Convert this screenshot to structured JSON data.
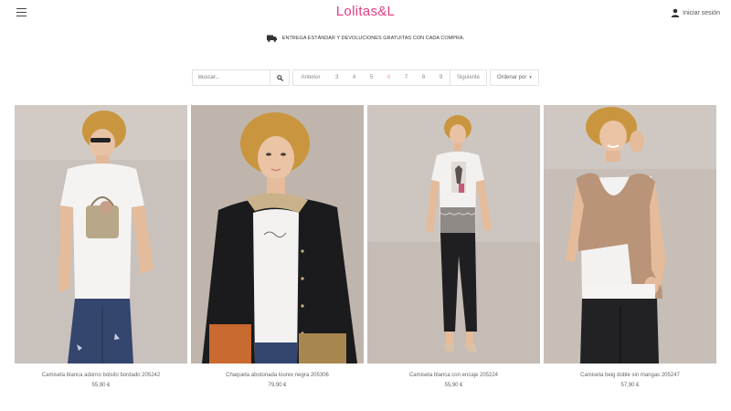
{
  "header": {
    "brand": "Lolitas&L",
    "login_label": "Iniciar sesión",
    "brand_color": "#e63c86"
  },
  "banner": {
    "text": "ENTREGA ESTÁNDAR Y DEVOLUCIONES GRATUITAS CON CADA COMPRA."
  },
  "toolbar": {
    "search_placeholder": "Buscar...",
    "prev_label": "Anterior",
    "pages": [
      "3",
      "4",
      "5",
      "6",
      "7",
      "8",
      "9"
    ],
    "current_page": "6",
    "next_label": "Siguiente",
    "sort_label": "Ordenar por",
    "active_color": "#f29bbb"
  },
  "products": [
    {
      "name": "Camiseta blanca adorno bolsito bordado 205242",
      "price": "55,90 €"
    },
    {
      "name": "Chaqueta abotonada lourex negra 205306",
      "price": "79,90 €"
    },
    {
      "name": "Camiseta blanca con encaje 205224",
      "price": "55,90 €"
    },
    {
      "name": "Camiseta beig doble sin mangas 205247",
      "price": "57,90 €"
    }
  ],
  "icons": {
    "menu": "hamburger-icon",
    "user": "user-icon",
    "truck": "truck-icon",
    "search": "search-icon"
  }
}
